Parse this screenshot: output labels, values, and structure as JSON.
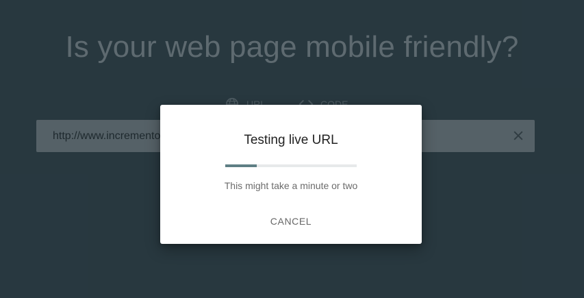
{
  "hero": {
    "title": "Is your web page mobile friendly?"
  },
  "mode_tabs": [
    {
      "label": "URL",
      "icon": "globe-icon"
    },
    {
      "label": "CODE",
      "icon": "code-icon"
    }
  ],
  "url_bar": {
    "value": "http://www.incrementors.com/",
    "clear_icon": "close-icon"
  },
  "dialog": {
    "title": "Testing live URL",
    "message": "This might take a minute or two",
    "cancel_label": "CANCEL",
    "progress_fraction": 0.24
  },
  "colors": {
    "page_bg": "#2f4048",
    "dialog_bg": "#ffffff",
    "progress_accent": "#5f7f85"
  }
}
